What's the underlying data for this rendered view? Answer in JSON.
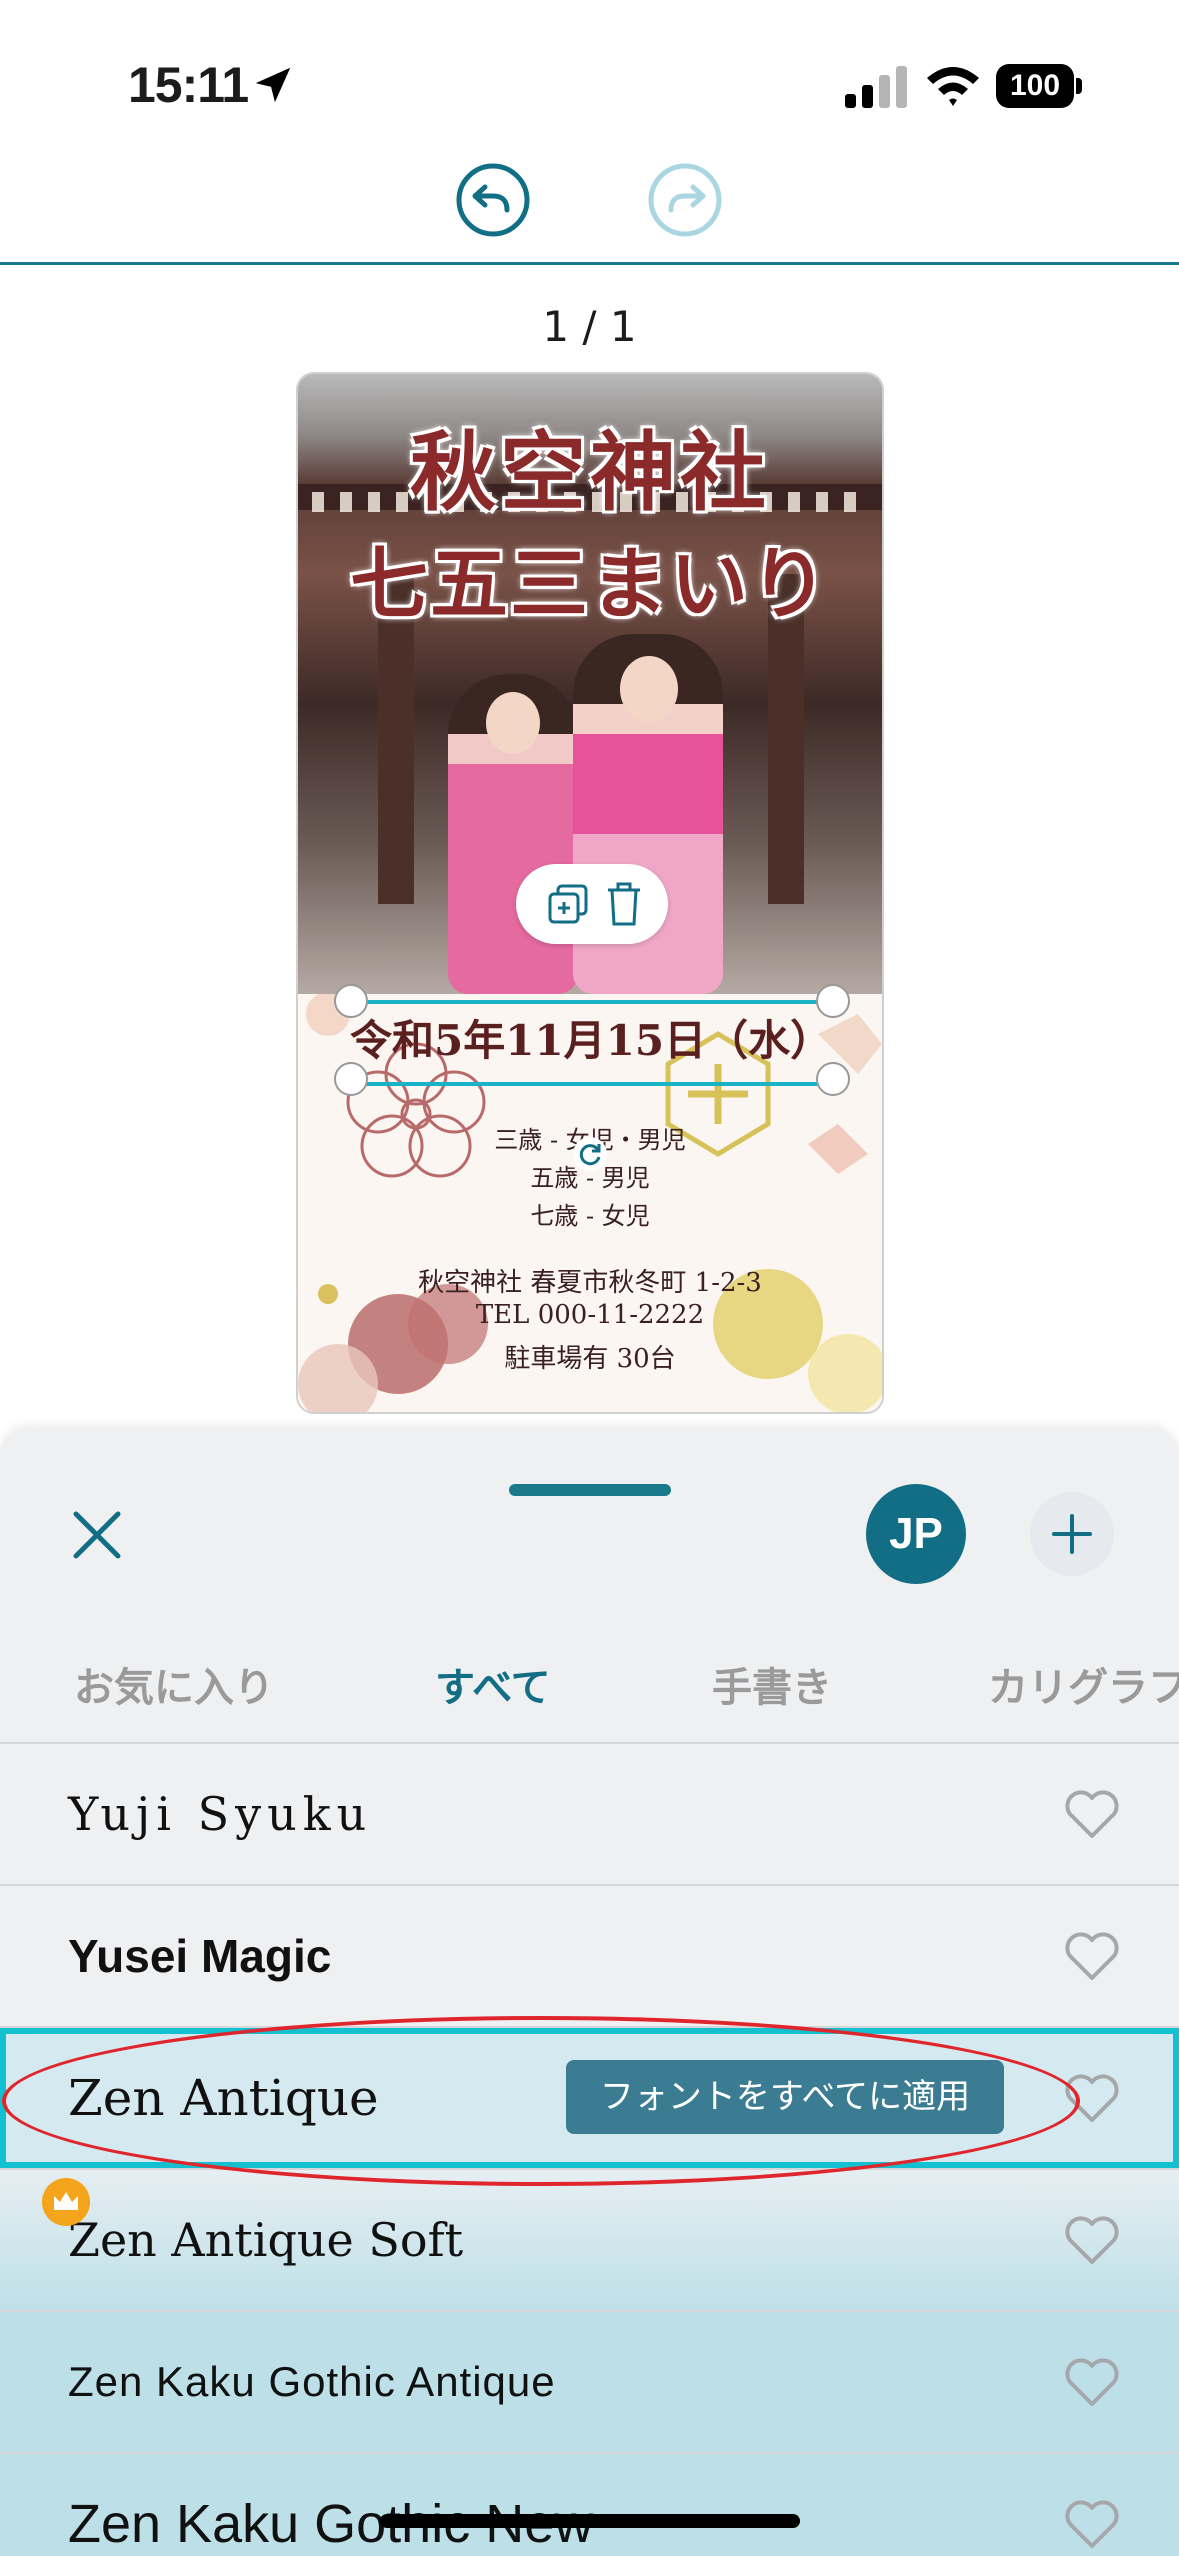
{
  "status_bar": {
    "time": "15:11",
    "battery": "100"
  },
  "toolbar": {
    "undo_icon": "undo-arrow-icon",
    "redo_icon": "redo-arrow-icon"
  },
  "page_indicator": "1 / 1",
  "design": {
    "title_line1": "秋空神社",
    "title_line2": "七五三まいり",
    "date": "令和5年11月15日（水）",
    "info_lines": [
      "三歳 - 女児・男児",
      "五歳 - 男児",
      "七歳 - 女児"
    ],
    "address": "秋空神社 春夏市秋冬町 1-2-3",
    "tel": "TEL 000-11-2222",
    "parking": "駐車場有 30台"
  },
  "sheet": {
    "language_button": "JP",
    "tabs": [
      {
        "label": "お気に入り",
        "active": false
      },
      {
        "label": "すべて",
        "active": true
      },
      {
        "label": "手書き",
        "active": false
      },
      {
        "label": "カリグラフ",
        "active": false
      }
    ],
    "fonts": [
      {
        "name": "Yuji Syuku"
      },
      {
        "name": "Yusei Magic"
      },
      {
        "name": "Zen Antique",
        "selected": true
      },
      {
        "name": "Zen Antique Soft",
        "premium": true
      },
      {
        "name": "Zen Kaku Gothic Antique"
      },
      {
        "name": "Zen Kaku Gothic New"
      }
    ],
    "apply_all_label": "フォントをすべてに適用"
  },
  "colors": {
    "accent": "#116e85",
    "selection": "#12c0d0",
    "annotation": "#e0262d"
  }
}
